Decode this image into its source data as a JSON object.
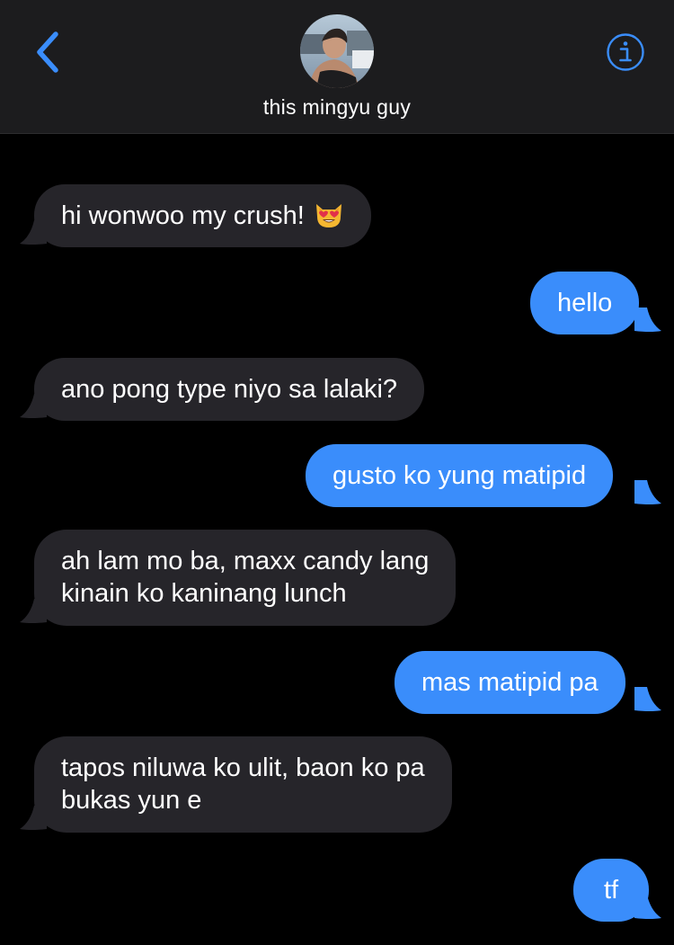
{
  "header": {
    "contact_name": "this mingyu guy",
    "back_icon": "chevron-left-icon",
    "info_icon": "info-circle-icon",
    "accent_color": "#3a8dfb"
  },
  "messages": [
    {
      "direction": "incoming",
      "text": "hi wonwoo my crush!",
      "emoji": "smiling-cat-heart-eyes-emoji"
    },
    {
      "direction": "outgoing",
      "text": "hello"
    },
    {
      "direction": "incoming",
      "text": "ano pong type niyo sa lalaki?"
    },
    {
      "direction": "outgoing",
      "text": "gusto ko yung matipid"
    },
    {
      "direction": "incoming",
      "lines": [
        "ah lam mo ba, maxx candy lang",
        "kinain ko kaninang lunch"
      ]
    },
    {
      "direction": "outgoing",
      "text": "mas matipid pa"
    },
    {
      "direction": "incoming",
      "lines": [
        "tapos niluwa ko ulit, baon ko pa",
        "bukas yun e"
      ]
    },
    {
      "direction": "outgoing",
      "text": "tf"
    }
  ],
  "colors": {
    "incoming_bubble": "#26252a",
    "outgoing_bubble": "#3a8dfb",
    "header_bg": "#1c1c1e",
    "background": "#000000"
  }
}
